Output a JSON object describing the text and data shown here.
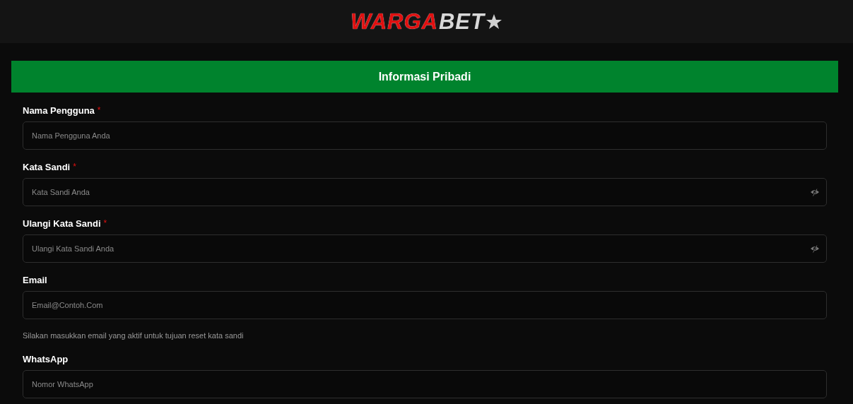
{
  "header": {
    "logo": {
      "parts": [
        "WARGA",
        "BET"
      ]
    }
  },
  "section": {
    "title": "Informasi Pribadi"
  },
  "fields": [
    {
      "kind": "text",
      "label": "Nama Pengguna",
      "mark": "*",
      "placeholder": "Nama Pengguna Anda"
    },
    {
      "kind": "password",
      "label": "Kata Sandi",
      "mark": "*",
      "placeholder": "Kata Sandi Anda"
    },
    {
      "kind": "password",
      "label": "Ulangi Kata Sandi",
      "mark": "*",
      "placeholder": "Ulangi Kata Sandi Anda"
    },
    {
      "kind": "text",
      "label": "Email",
      "placeholder": "Email@Contoh.Com",
      "helper": "Silakan masukkan email yang aktif untuk tujuan reset kata sandi"
    },
    {
      "kind": "text",
      "label": "WhatsApp",
      "placeholder": "Nomor WhatsApp"
    }
  ]
}
